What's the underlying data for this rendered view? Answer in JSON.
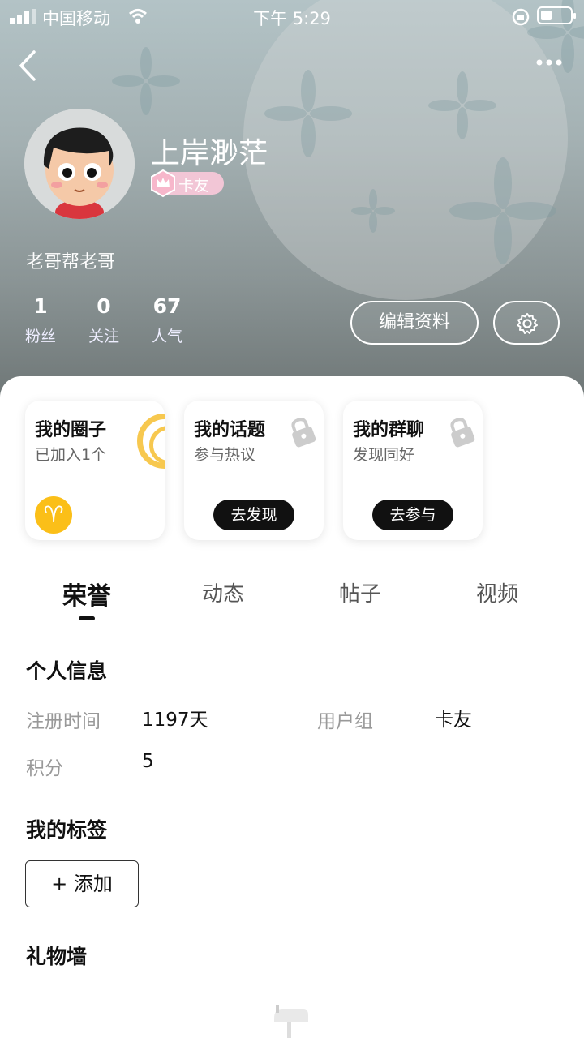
{
  "status_bar": {
    "carrier": "中国移动",
    "time": "下午 5:29"
  },
  "profile": {
    "username": "上岸渺茫",
    "badge": "卡友",
    "signature": "老哥帮老哥",
    "stats": [
      {
        "value": "1",
        "label": "粉丝"
      },
      {
        "value": "0",
        "label": "关注"
      },
      {
        "value": "67",
        "label": "人气"
      }
    ],
    "edit_label": "编辑资料"
  },
  "cards": [
    {
      "title": "我的圈子",
      "subtitle": "已加入1个"
    },
    {
      "title": "我的话题",
      "subtitle": "参与热议",
      "action": "去发现"
    },
    {
      "title": "我的群聊",
      "subtitle": "发现同好",
      "action": "去参与"
    }
  ],
  "tabs": [
    "荣誉",
    "动态",
    "帖子",
    "视频"
  ],
  "active_tab": "荣誉",
  "personal_info": {
    "title": "个人信息",
    "reg_label": "注册时间",
    "reg_value": "1197天",
    "group_label": "用户组",
    "group_value": "卡友",
    "points_label": "积分",
    "points_value": "5"
  },
  "tags": {
    "title": "我的标签",
    "add_label": "+ 添加"
  },
  "gifts": {
    "title": "礼物墙"
  },
  "colors": {
    "accent_yellow": "#fbbf18",
    "badge_pink": "#f2c6d6",
    "dark": "#111111"
  }
}
